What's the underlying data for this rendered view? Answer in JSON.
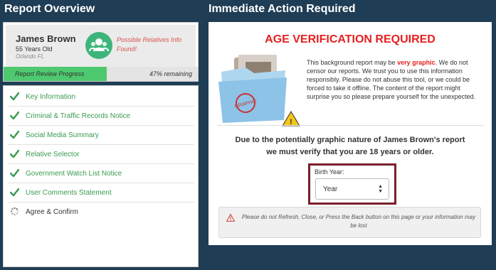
{
  "left": {
    "title": "Report Overview"
  },
  "right": {
    "title": "Immediate Action Required"
  },
  "profile": {
    "name": "James Brown",
    "age": "55 Years Old",
    "location": "Orlando FL",
    "relatives_notice": "Possible Relatives Info Found!",
    "avatar_icon": "group-people-icon"
  },
  "progress": {
    "label": "Report Review Progress",
    "remaining_text": "47% remaining",
    "completed_fraction": 0.53,
    "fill_color": "#4ec96f"
  },
  "checklist": [
    {
      "label": "Key Information",
      "status": "done"
    },
    {
      "label": "Criminal & Traffic Records Notice",
      "status": "done"
    },
    {
      "label": "Social Media Summary",
      "status": "done"
    },
    {
      "label": "Relative Selector",
      "status": "done"
    },
    {
      "label": "Government Watch List Notice",
      "status": "done"
    },
    {
      "label": "User Comments Statement",
      "status": "done"
    },
    {
      "label": "Agree & Confirm",
      "status": "loading"
    }
  ],
  "age_verification": {
    "title": "AGE VERIFICATION REQUIRED",
    "text_before": "This background report may be ",
    "text_highlight": "very graphic",
    "text_after": ". We do not censor our reports. We trust you to use this information responsibly. Please do not abuse this tool, or we could be forced to take it offline. The content of the report might surprise you so please prepare yourself for the unexpected.",
    "graphic_message_line1": "Due to the potentially graphic nature of James Brown's report",
    "graphic_message_line2": "we must verify that you are 18 years or older.",
    "birth_year_label": "Birth Year:",
    "birth_year_value": "Year",
    "notice": "Please do not Refresh, Close, or Press the Back button on this page or your information may be lost",
    "folder_stamp": "GRAPHIC"
  },
  "colors": {
    "background": "#1f3d55",
    "accent_red": "#e52020",
    "check_green": "#3a9a50",
    "highlight_border": "#7a1f2b"
  }
}
